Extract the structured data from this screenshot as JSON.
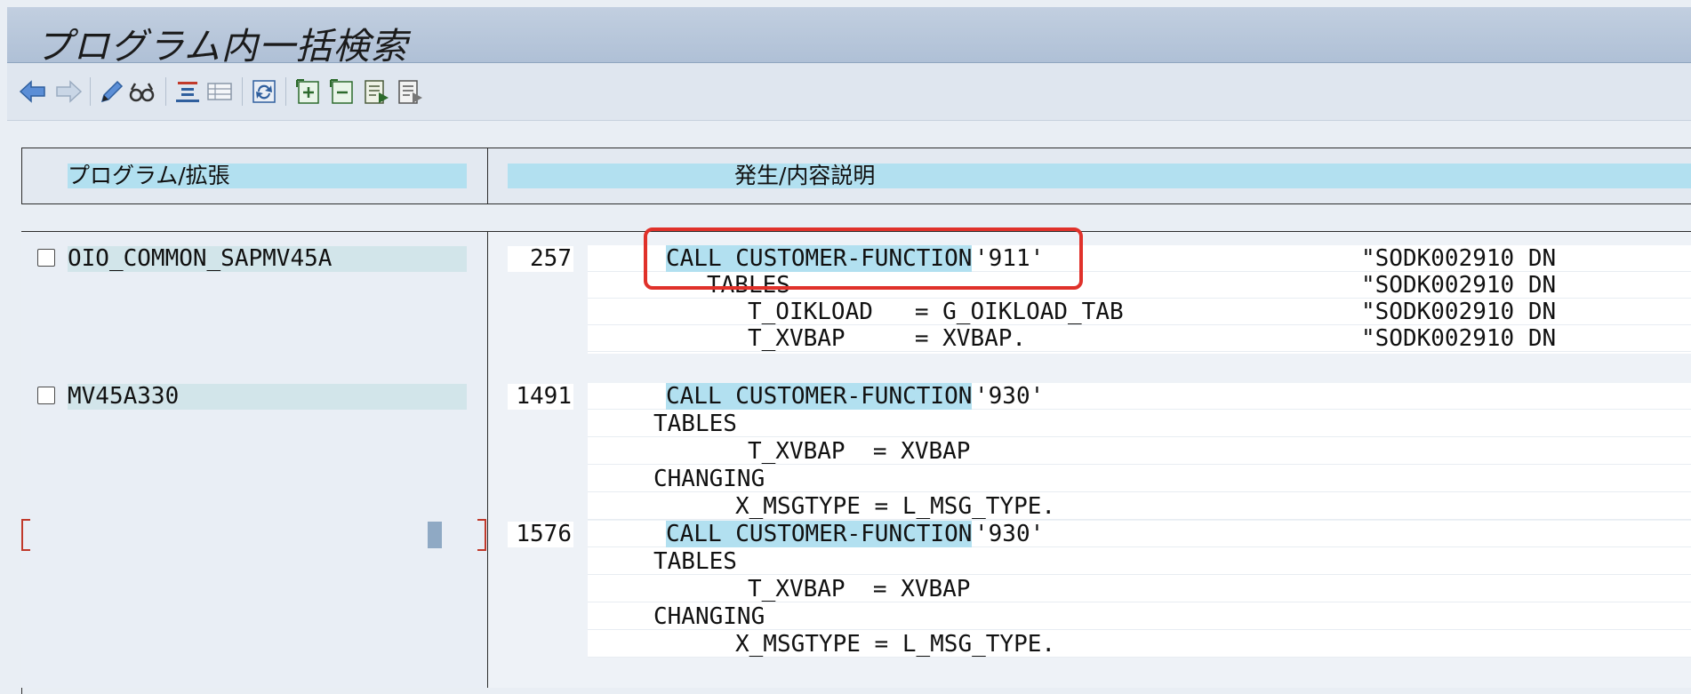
{
  "window": {
    "title": "プログラム内一括検索"
  },
  "toolbar": {
    "buttons": [
      {
        "name": "back-icon"
      },
      {
        "name": "forward-icon"
      },
      {
        "name": "edit-icon"
      },
      {
        "name": "display-icon"
      },
      {
        "name": "structure-icon"
      },
      {
        "name": "list-icon"
      },
      {
        "name": "refresh-icon"
      },
      {
        "name": "expand-icon"
      },
      {
        "name": "collapse-icon"
      },
      {
        "name": "select-icon"
      },
      {
        "name": "deselect-icon"
      }
    ]
  },
  "header": {
    "col_program": "プログラム/拡張",
    "col_occurrence": "発生/内容説明"
  },
  "results": [
    {
      "program": "OIO_COMMON_SAPMV45A",
      "line": "257",
      "code": [
        {
          "code": "CALL CUSTOMER-FUNCTION",
          "rest": "'911'",
          "comment": "\"SODK002910 DN"
        },
        {
          "code": "TABLES",
          "rest": "",
          "comment": "\"SODK002910 DN"
        },
        {
          "code": "T_OIKLOAD   = G_OIKLOAD_TAB",
          "rest": "",
          "comment": "\"SODK002910 DN"
        },
        {
          "code": "T_XVBAP     = XVBAP.",
          "rest": "",
          "comment": "\"SODK002910 DN"
        }
      ]
    },
    {
      "program": "MV45A330",
      "line": "1491",
      "code": [
        {
          "code": "CALL CUSTOMER-FUNCTION",
          "rest": "'930'"
        },
        {
          "code": "TABLES",
          "rest": ""
        },
        {
          "code": "T_XVBAP  = XVBAP",
          "rest": ""
        },
        {
          "code": "CHANGING",
          "rest": ""
        },
        {
          "code": "X_MSGTYPE = L_MSG_TYPE.",
          "rest": ""
        }
      ]
    },
    {
      "program": "",
      "line": "1576",
      "code": [
        {
          "code": "CALL CUSTOMER-FUNCTION",
          "rest": "'930'"
        },
        {
          "code": "TABLES",
          "rest": ""
        },
        {
          "code": "T_XVBAP  = XVBAP",
          "rest": ""
        },
        {
          "code": "CHANGING",
          "rest": ""
        },
        {
          "code": "X_MSGTYPE = L_MSG_TYPE.",
          "rest": ""
        }
      ]
    }
  ]
}
